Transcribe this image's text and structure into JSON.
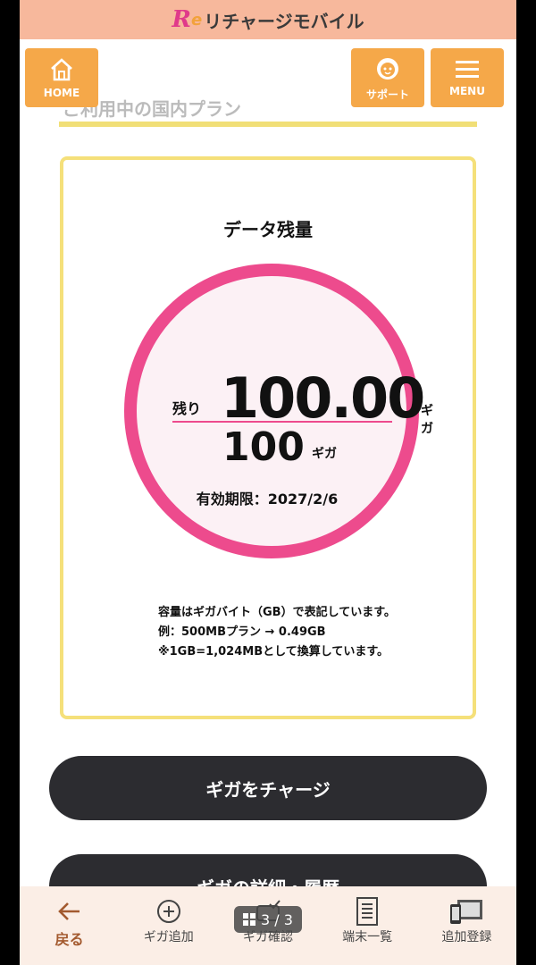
{
  "app": {
    "title": "リチャージモバイル"
  },
  "nav": {
    "home_label": "HOME",
    "support_label": "サポート",
    "menu_label": "MENU"
  },
  "section_heading": "ご利用中の国内プラン",
  "data_card": {
    "title": "データ残量",
    "remaining_label": "残り",
    "remaining_value": "100.00",
    "remaining_unit": "ギガ",
    "total_value": "100",
    "total_unit": "ギガ",
    "expiry": "有効期限：2027/2/6",
    "notes": [
      "容量はギガバイト（GB）で表記しています。",
      "例：500MBプラン → 0.49GB",
      "※1GB=1,024MBとして換算しています。"
    ]
  },
  "buttons": {
    "charge": "ギガをチャージ",
    "detail": "ギガの詳細・履歴"
  },
  "tabbar": {
    "items": [
      {
        "label": "戻る",
        "icon": "arrow-left-icon"
      },
      {
        "label": "ギガ追加",
        "icon": "plus-circle-icon"
      },
      {
        "label": "ギガ確認",
        "icon": "check-icon"
      },
      {
        "label": "端末一覧",
        "icon": "list-icon"
      },
      {
        "label": "追加登録",
        "icon": "devices-icon"
      }
    ]
  },
  "pager": {
    "text": "3 / 3"
  },
  "colors": {
    "top_bar": "#f7b89c",
    "nav_button": "#f5a849",
    "ring": "#ed4b8d",
    "card_border": "#f5e07a",
    "dark_button": "#2c2c30"
  }
}
